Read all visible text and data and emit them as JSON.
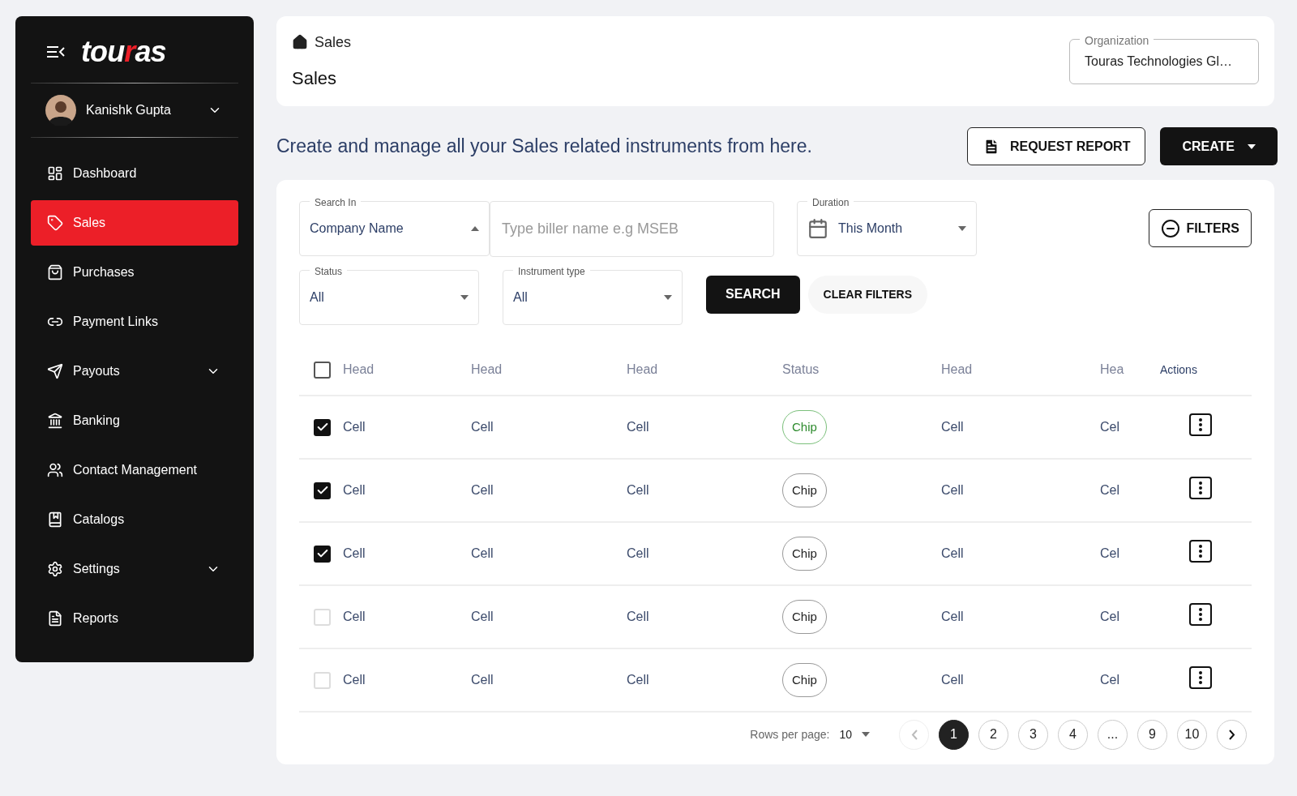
{
  "sidebar": {
    "logo": [
      {
        "text": "tou",
        "accent": false
      },
      {
        "text": "r",
        "accent": true
      },
      {
        "text": "as",
        "accent": false
      }
    ],
    "user": {
      "name": "Kanishk Gupta"
    },
    "items": [
      {
        "label": "Dashboard",
        "selected": false,
        "expandable": false
      },
      {
        "label": "Sales",
        "selected": true,
        "expandable": false
      },
      {
        "label": "Purchases",
        "selected": false,
        "expandable": false
      },
      {
        "label": "Payment Links",
        "selected": false,
        "expandable": false
      },
      {
        "label": "Payouts",
        "selected": false,
        "expandable": true
      },
      {
        "label": "Banking",
        "selected": false,
        "expandable": false
      },
      {
        "label": "Contact Management",
        "selected": false,
        "expandable": false
      },
      {
        "label": "Catalogs",
        "selected": false,
        "expandable": false
      },
      {
        "label": "Settings",
        "selected": false,
        "expandable": true
      },
      {
        "label": "Reports",
        "selected": false,
        "expandable": false
      }
    ]
  },
  "header": {
    "breadcrumb": "Sales",
    "title": "Sales",
    "organization": {
      "label": "Organization",
      "value": "Touras Technologies Gl…"
    }
  },
  "tagline": "Create and manage all your Sales related instruments from here.",
  "actions": {
    "request_report": "REQUEST REPORT",
    "create": "CREATE"
  },
  "filters": {
    "search_in": {
      "label": "Search In",
      "value": "Company Name"
    },
    "search": {
      "placeholder": "Type biller name e.g MSEB"
    },
    "duration": {
      "label": "Duration",
      "value": "This Month"
    },
    "filters_button": "FILTERS",
    "status": {
      "label": "Status",
      "value": "All"
    },
    "instrument_type": {
      "label": "Instrument type",
      "value": "All"
    },
    "search_button": "SEARCH",
    "clear_button": "CLEAR FILTERS"
  },
  "table": {
    "all_checked": false,
    "columns": [
      "Head",
      "Head",
      "Head",
      "Status",
      "Head",
      "Hea",
      "Actions"
    ],
    "rows": [
      {
        "checked": true,
        "cells": [
          "Cell",
          "Cell",
          "Cell"
        ],
        "chip": {
          "label": "Chip",
          "kind": "success"
        },
        "cells2": [
          "Cell",
          "Cel"
        ]
      },
      {
        "checked": true,
        "cells": [
          "Cell",
          "Cell",
          "Cell"
        ],
        "chip": {
          "label": "Chip",
          "kind": "default"
        },
        "cells2": [
          "Cell",
          "Cel"
        ]
      },
      {
        "checked": true,
        "cells": [
          "Cell",
          "Cell",
          "Cell"
        ],
        "chip": {
          "label": "Chip",
          "kind": "default"
        },
        "cells2": [
          "Cell",
          "Cel"
        ]
      },
      {
        "checked": false,
        "cells": [
          "Cell",
          "Cell",
          "Cell"
        ],
        "chip": {
          "label": "Chip",
          "kind": "default"
        },
        "cells2": [
          "Cell",
          "Cel"
        ]
      },
      {
        "checked": false,
        "cells": [
          "Cell",
          "Cell",
          "Cell"
        ],
        "chip": {
          "label": "Chip",
          "kind": "default"
        },
        "cells2": [
          "Cell",
          "Cel"
        ]
      }
    ]
  },
  "pagination": {
    "rows_label": "Rows per page:",
    "rows_value": "10",
    "pages": [
      {
        "label": "1",
        "selected": true
      },
      {
        "label": "2",
        "selected": false
      },
      {
        "label": "3",
        "selected": false
      },
      {
        "label": "4",
        "selected": false
      },
      {
        "label": "...",
        "selected": false
      },
      {
        "label": "9",
        "selected": false
      },
      {
        "label": "10",
        "selected": false
      }
    ]
  }
}
